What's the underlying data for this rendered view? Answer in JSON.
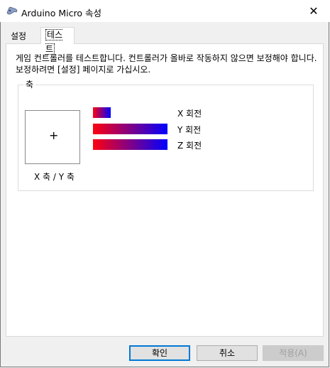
{
  "window": {
    "title": "Arduino Micro 속성",
    "close_glyph": "✕"
  },
  "tabs": [
    {
      "label": "설정"
    },
    {
      "label": "테스트"
    }
  ],
  "test": {
    "description": "게임 컨트롤러를 테스트합니다. 컨트롤러가 올바로 작동하지 않으면 보정해야 합니다. 보정하려면 [설정] 페이지로 가십시오.",
    "axes_group_label": "축",
    "crosshair": "+",
    "xy_label": "X 축 / Y 축",
    "rotations": [
      {
        "label": "X 회전",
        "level": 0.24
      },
      {
        "label": "Y 회전",
        "level": 1.0
      },
      {
        "label": "Z 회전",
        "level": 1.0
      }
    ]
  },
  "buttons": {
    "ok": "확인",
    "cancel": "취소",
    "apply": "적용(A)"
  },
  "colors": {
    "bar_start": "#ff0010",
    "bar_end": "#0000ff",
    "focus": "#0078d7"
  },
  "icons": {
    "title": "gamepad-icon",
    "close": "close-icon"
  }
}
